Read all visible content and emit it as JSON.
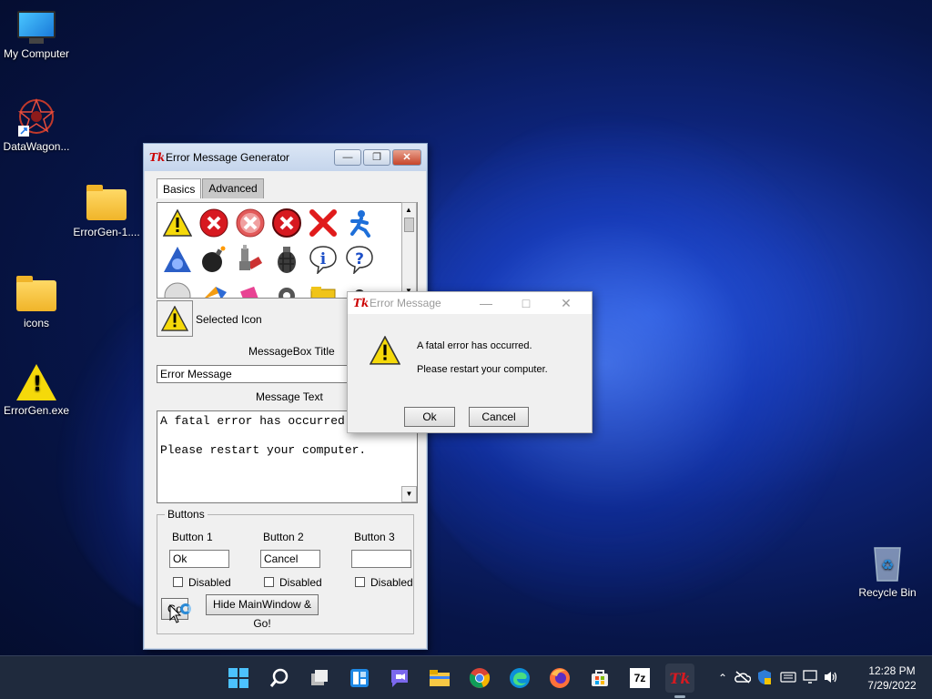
{
  "desktop": {
    "icons": [
      {
        "label": "My Computer"
      },
      {
        "label": "DataWagon..."
      },
      {
        "label": "ErrorGen-1...."
      },
      {
        "label": "icons"
      },
      {
        "label": "ErrorGen.exe"
      },
      {
        "label": "Recycle Bin"
      }
    ]
  },
  "main_window": {
    "title": "Error Message Generator",
    "logo": "Tk",
    "tabs": [
      {
        "label": "Basics",
        "active": true
      },
      {
        "label": "Advanced",
        "active": false
      }
    ],
    "icon_grid_icons": [
      "warning-icon",
      "error-icon",
      "error-gray-icon",
      "error-icon",
      "red-x-icon",
      "running-man-icon",
      "triangle-icon",
      "bomb-icon",
      "plug-icon",
      "grenade-icon",
      "info-icon",
      "question-icon",
      "cd-icon",
      "colorful-icon",
      "pink-icon",
      "gear-icon",
      "folder-icon",
      "bug-icon"
    ],
    "selected_icon_label": "Selected Icon",
    "messagebox_title_label": "MessageBox Title",
    "messagebox_title_value": "Error Message",
    "message_text_label": "Message Text",
    "message_text_line1": "A fatal error has occurred.",
    "message_text_line2": "Please restart your computer.",
    "buttons_group_label": "Buttons",
    "button1_label": "Button 1",
    "button2_label": "Button 2",
    "button3_label": "Button 3",
    "button1_value": "Ok",
    "button2_value": "Cancel",
    "button3_value": "",
    "disabled_label": "Disabled",
    "go_label": "Go",
    "hide_go_label": "Hide MainWindow & Go!"
  },
  "dialog": {
    "title": "Error Message",
    "logo": "Tk",
    "line1": "A fatal error has occurred.",
    "line2": "Please restart your computer.",
    "ok_label": "Ok",
    "cancel_label": "Cancel"
  },
  "taskbar": {
    "icons": [
      "start-icon",
      "search-icon",
      "task-view-icon",
      "widgets-icon",
      "chat-icon",
      "file-explorer-icon",
      "chrome-icon",
      "edge-icon",
      "firefox-icon",
      "store-icon",
      "7zip-icon",
      "tk-icon"
    ],
    "seven_zip_text": "7z",
    "tk_text": "Tk",
    "time": "12:28 PM",
    "date": "7/29/2022"
  },
  "colors": {
    "accent": "#0078d4",
    "warning": "#f5d90a",
    "error": "#d71920"
  }
}
